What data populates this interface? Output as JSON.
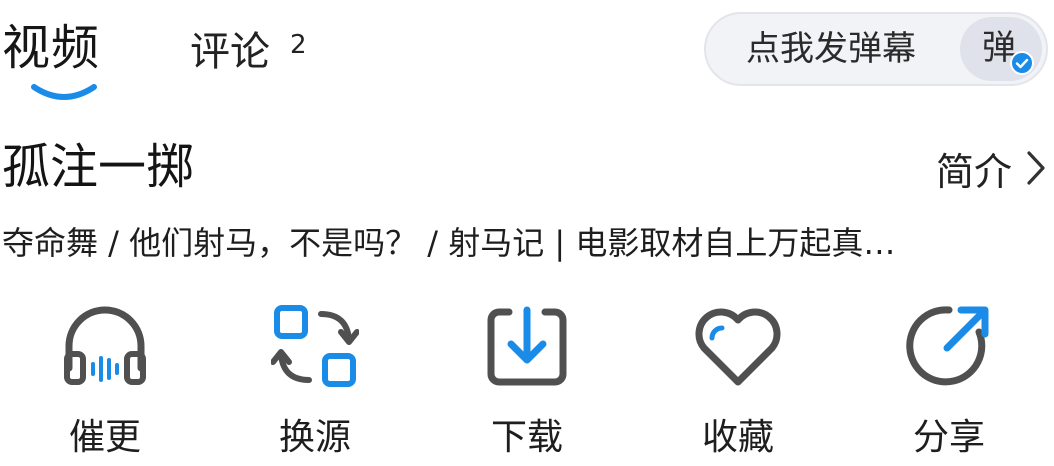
{
  "header": {
    "tabs": [
      {
        "label": "视频",
        "active": true
      },
      {
        "label": "评论",
        "count": "2",
        "active": false
      }
    ],
    "danmaku": {
      "placeholder": "点我发弹幕",
      "toggle_label": "弹",
      "enabled": true
    }
  },
  "video": {
    "title": "孤注一掷",
    "intro_label": "简介",
    "description": "夺命舞 / 他们射马，不是吗？ / 射马记 | 电影取材自上万起真…"
  },
  "actions": [
    {
      "label": "催更",
      "icon": "headphones-icon"
    },
    {
      "label": "换源",
      "icon": "switch-source-icon"
    },
    {
      "label": "下载",
      "icon": "download-icon"
    },
    {
      "label": "收藏",
      "icon": "heart-icon"
    },
    {
      "label": "分享",
      "icon": "share-icon"
    }
  ],
  "colors": {
    "accent": "#1a8ce8",
    "icon_gray": "#505050",
    "pill_bg": "#f2f3f6"
  }
}
